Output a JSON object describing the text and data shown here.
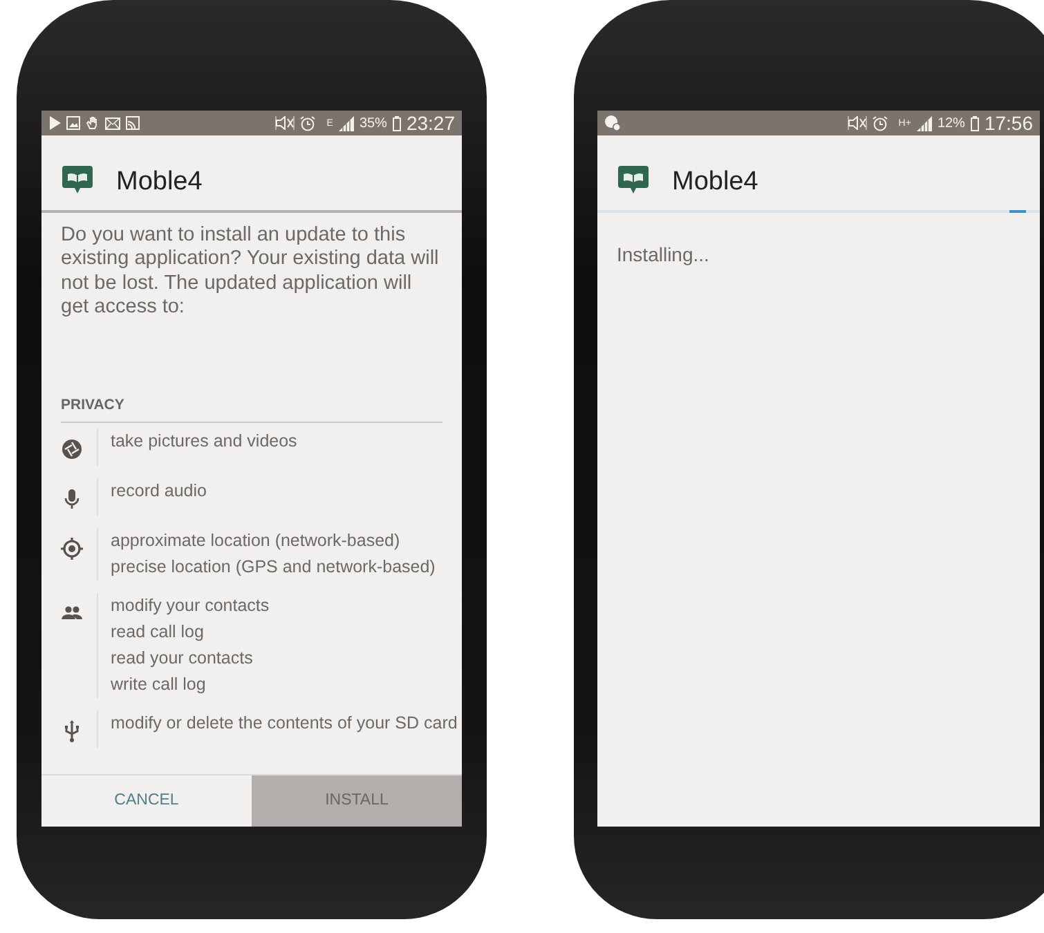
{
  "phones": [
    {
      "status_bar": {
        "network": "E",
        "battery": "35%",
        "time": "23:27"
      },
      "app_title": "Moble4",
      "kind": "permissions",
      "message": "Do you want to install an update to this existing application? Your existing data will not be lost. The updated application will get access to:",
      "section": "PRIVACY",
      "permission_groups": [
        {
          "kind": "camera",
          "items": [
            "take pictures and videos"
          ]
        },
        {
          "kind": "microphone",
          "items": [
            "record audio"
          ]
        },
        {
          "kind": "location",
          "items": [
            "approximate location (network-based)",
            "precise location (GPS and network-based)"
          ]
        },
        {
          "kind": "contacts",
          "items": [
            "modify your contacts",
            "read call log",
            "read your contacts",
            "write call log"
          ]
        },
        {
          "kind": "storage",
          "items": [
            "modify or delete the contents of your SD card"
          ]
        }
      ],
      "buttons": [
        {
          "label": "CANCEL",
          "disabled": false
        },
        {
          "label": "INSTALL",
          "disabled": true
        }
      ]
    },
    {
      "status_bar": {
        "network": "H+",
        "battery": "12%",
        "time": "17:56"
      },
      "app_title": "Moble4",
      "kind": "installing",
      "status_text": "Installing..."
    }
  ]
}
